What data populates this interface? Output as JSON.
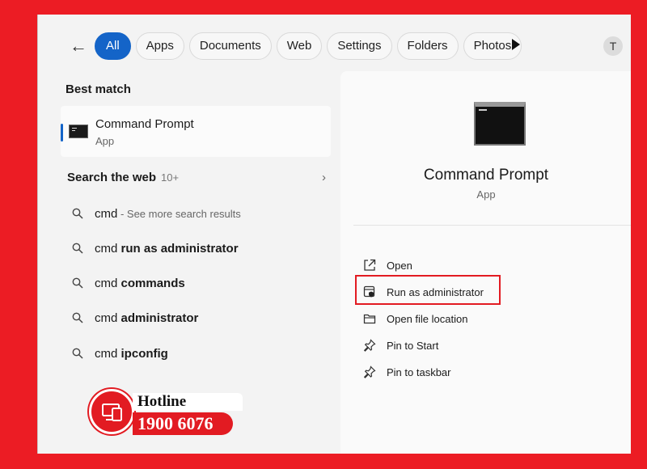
{
  "filters": {
    "back_icon": "arrow-left-icon",
    "tabs": [
      {
        "label": "All",
        "active": true
      },
      {
        "label": "Apps",
        "active": false
      },
      {
        "label": "Documents",
        "active": false
      },
      {
        "label": "Web",
        "active": false
      },
      {
        "label": "Settings",
        "active": false
      },
      {
        "label": "Folders",
        "active": false
      },
      {
        "label": "Photos",
        "active": false
      }
    ],
    "more_icon": "play-icon",
    "avatar_initial": "T",
    "accent_color": "#1464c8"
  },
  "best_match": {
    "heading": "Best match",
    "name": "Command Prompt",
    "type": "App"
  },
  "web_search": {
    "heading": "Search the web",
    "count": "10+",
    "items": [
      {
        "prefix": "cmd",
        "bold": "",
        "suffix": " - See more search results"
      },
      {
        "prefix": "cmd ",
        "bold": "run as administrator",
        "suffix": ""
      },
      {
        "prefix": "cmd ",
        "bold": "commands",
        "suffix": ""
      },
      {
        "prefix": "cmd ",
        "bold": "administrator",
        "suffix": ""
      },
      {
        "prefix": "cmd ",
        "bold": "ipconfig",
        "suffix": ""
      }
    ]
  },
  "preview": {
    "name": "Command Prompt",
    "type": "App",
    "actions": [
      {
        "label": "Open",
        "icon": "open-external-icon"
      },
      {
        "label": "Run as administrator",
        "icon": "shield-admin-icon"
      },
      {
        "label": "Open file location",
        "icon": "folder-icon"
      },
      {
        "label": "Pin to Start",
        "icon": "pin-icon"
      },
      {
        "label": "Pin to taskbar",
        "icon": "pin-icon"
      }
    ],
    "highlight_color": "#e21b22"
  },
  "hotline": {
    "label": "Hotline",
    "number": "1900 6076",
    "brand_color": "#e21b22"
  }
}
